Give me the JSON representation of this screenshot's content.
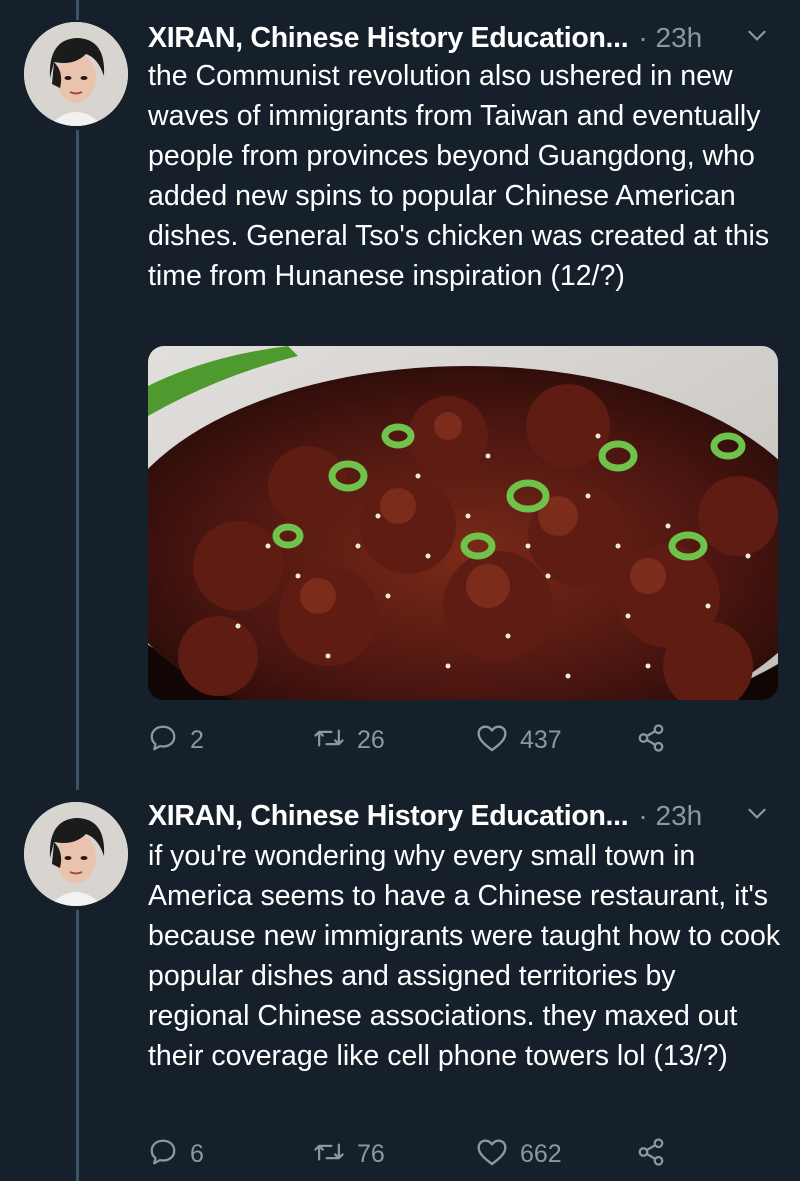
{
  "tweets": [
    {
      "author": "XIRAN, Chinese History Education...",
      "time": "· 23h",
      "text": "the Communist revolution also ushered in new waves of immigrants from Taiwan and eventually people from provinces beyond Guangdong, who added new spins to popular Chinese American dishes. General Tso's chicken was created at this time from Hunanese inspiration (12/?)",
      "counts": {
        "replies": "2",
        "retweets": "26",
        "likes": "437"
      }
    },
    {
      "author": "XIRAN, Chinese History Education...",
      "time": "· 23h",
      "text": "if you're wondering why every small town in America seems to have a Chinese restaurant, it's because new immigrants were taught how to cook popular dishes and assigned territories by regional Chinese associations. they maxed out their coverage like cell phone towers lol (13/?)",
      "counts": {
        "replies": "6",
        "retweets": "76",
        "likes": "662"
      }
    }
  ],
  "icons": [
    "reply-icon",
    "retweet-icon",
    "like-icon",
    "share-icon",
    "chevron-down-icon"
  ],
  "colors": {
    "background": "#15202b",
    "secondary_text": "#8899a6",
    "thread_line": "#3d5466"
  }
}
